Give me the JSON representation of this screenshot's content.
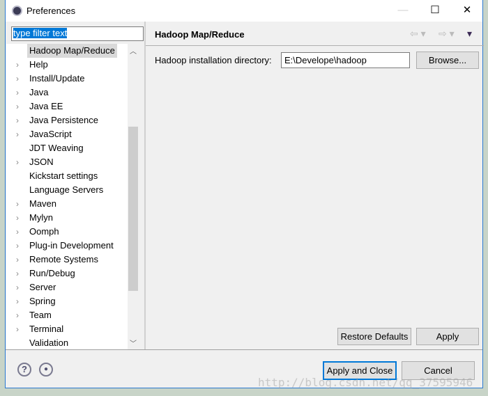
{
  "window": {
    "title": "Preferences"
  },
  "filter": {
    "value": "type filter text"
  },
  "tree": [
    {
      "label": "Hadoop Map/Reduce",
      "expandable": false,
      "selected": true
    },
    {
      "label": "Help",
      "expandable": true
    },
    {
      "label": "Install/Update",
      "expandable": true
    },
    {
      "label": "Java",
      "expandable": true
    },
    {
      "label": "Java EE",
      "expandable": true
    },
    {
      "label": "Java Persistence",
      "expandable": true
    },
    {
      "label": "JavaScript",
      "expandable": true
    },
    {
      "label": "JDT Weaving",
      "expandable": false
    },
    {
      "label": "JSON",
      "expandable": true
    },
    {
      "label": "Kickstart settings",
      "expandable": false
    },
    {
      "label": "Language Servers",
      "expandable": false
    },
    {
      "label": "Maven",
      "expandable": true
    },
    {
      "label": "Mylyn",
      "expandable": true
    },
    {
      "label": "Oomph",
      "expandable": true
    },
    {
      "label": "Plug-in Development",
      "expandable": true
    },
    {
      "label": "Remote Systems",
      "expandable": true
    },
    {
      "label": "Run/Debug",
      "expandable": true
    },
    {
      "label": "Server",
      "expandable": true
    },
    {
      "label": "Spring",
      "expandable": true
    },
    {
      "label": "Team",
      "expandable": true
    },
    {
      "label": "Terminal",
      "expandable": true
    },
    {
      "label": "Validation",
      "expandable": false
    }
  ],
  "page": {
    "title": "Hadoop Map/Reduce",
    "dir_label": "Hadoop installation directory:",
    "dir_value": "E:\\Develope\\hadoop",
    "browse": "Browse...",
    "restore": "Restore Defaults",
    "apply": "Apply"
  },
  "footer": {
    "apply_close": "Apply and Close",
    "cancel": "Cancel"
  },
  "watermark": "http://blog.csdn.net/qq_37595946",
  "colors": {
    "accent": "#0078d7"
  }
}
